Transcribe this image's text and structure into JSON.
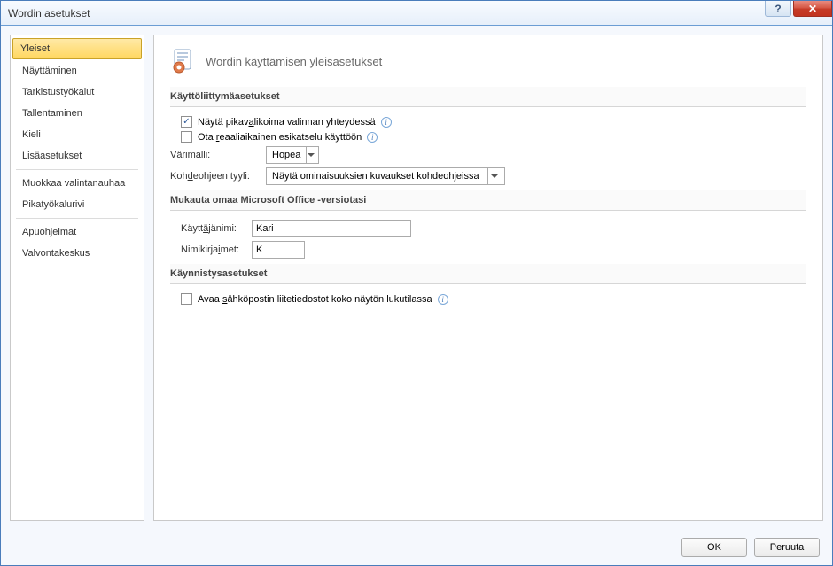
{
  "window": {
    "title": "Wordin asetukset"
  },
  "titlebar_icons": {
    "help": "?",
    "close": "✕"
  },
  "sidebar": {
    "items": [
      {
        "label": "Yleiset",
        "selected": true
      },
      {
        "label": "Näyttäminen"
      },
      {
        "label": "Tarkistustyökalut"
      },
      {
        "label": "Tallentaminen"
      },
      {
        "label": "Kieli"
      },
      {
        "label": "Lisäasetukset"
      }
    ],
    "items2": [
      {
        "label": "Muokkaa valintanauhaa"
      },
      {
        "label": "Pikatyökalurivi"
      }
    ],
    "items3": [
      {
        "label": "Apuohjelmat"
      },
      {
        "label": "Valvontakeskus"
      }
    ]
  },
  "content": {
    "header": "Wordin käyttämisen yleisasetukset",
    "section_ui": "Käyttöliittymäasetukset",
    "opt_minitoolbar": {
      "pre": "Näytä pikav",
      "u": "a",
      "post": "likoima valinnan yhteydessä",
      "checked": true
    },
    "opt_livepreview": {
      "pre": "Ota ",
      "u": "r",
      "post": "eaaliaikainen esikatselu käyttöön",
      "checked": false
    },
    "color_label_pre": "",
    "color_label_u": "V",
    "color_label_post": "ärimalli:",
    "color_value": "Hopea",
    "tips_label_pre": "Koh",
    "tips_label_u": "d",
    "tips_label_post": "eohjeen tyyli:",
    "tips_value": "Näytä ominaisuuksien kuvaukset kohdeohjeissa",
    "section_personal": "Mukauta omaa Microsoft Office -versiotasi",
    "username_label_pre": "Käytt",
    "username_label_u": "ä",
    "username_label_post": "jänimi:",
    "username_value": "Kari",
    "initials_label_pre": "Nimikirja",
    "initials_label_u": "i",
    "initials_label_post": "met:",
    "initials_value": "K",
    "section_startup": "Käynnistysasetukset",
    "opt_attachments": {
      "pre": "Avaa ",
      "u": "s",
      "post": "ähköpostin liitetiedostot koko näytön lukutilassa",
      "checked": false
    }
  },
  "footer": {
    "ok": "OK",
    "cancel": "Peruuta"
  }
}
